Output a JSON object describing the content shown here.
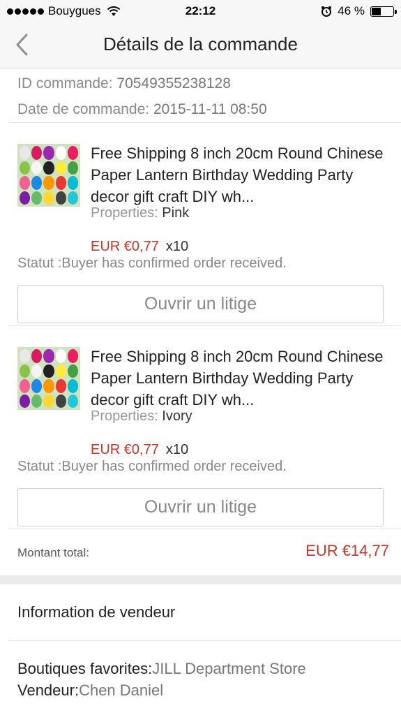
{
  "status_bar": {
    "carrier": "Bouygues",
    "time": "22:12",
    "battery": "46 %",
    "battery_level": 0.46
  },
  "nav": {
    "title": "Détails de la commande"
  },
  "order": {
    "id_label": "ID commande:",
    "id_value": "70549355238128",
    "date_label": "Date de commande:",
    "date_value": "2015-11-11 08:50"
  },
  "items": [
    {
      "title": "Free Shipping 8 inch 20cm Round Chinese Paper Lantern Birthday Wedding Party decor gift craft DIY wh...",
      "properties_label": "Properties:",
      "properties_value": "Pink",
      "price": "EUR €0,77",
      "qty": "x10",
      "status": "Statut :Buyer has confirmed order received.",
      "dispute_label": "Ouvrir un litige"
    },
    {
      "title": "Free Shipping 8 inch 20cm Round Chinese Paper Lantern Birthday Wedding Party decor gift craft DIY wh...",
      "properties_label": "Properties:",
      "properties_value": "Ivory",
      "price": "EUR €0,77",
      "qty": "x10",
      "status": "Statut :Buyer has confirmed order received.",
      "dispute_label": "Ouvrir un litige"
    }
  ],
  "total": {
    "label": "Montant total:",
    "value": "EUR €14,77"
  },
  "seller": {
    "header": "Information de vendeur",
    "store_label": "Boutiques favorites:",
    "store_value": "JILL Department Store",
    "seller_label": "Vendeur:",
    "seller_value": "Chen Daniel"
  },
  "colors": {
    "accent_red": "#c0392b",
    "lanterns": [
      "#e8e8e8",
      "#d81b60",
      "#9c27b0",
      "#ffffff",
      "#e91e63",
      "#8bc34a",
      "#f5f5f5",
      "#212121",
      "#ffeb3b",
      "#43a047",
      "#f06292",
      "#1e88e5",
      "#ff9800",
      "#e53935",
      "#00bcd4",
      "#7b1fa2",
      "#66bb6a",
      "#fdd835",
      "#424242",
      "#26c6da"
    ]
  },
  "icons": {
    "back": "chevron-left-icon",
    "wifi": "wifi-icon",
    "alarm": "alarm-icon",
    "battery": "battery-icon"
  }
}
